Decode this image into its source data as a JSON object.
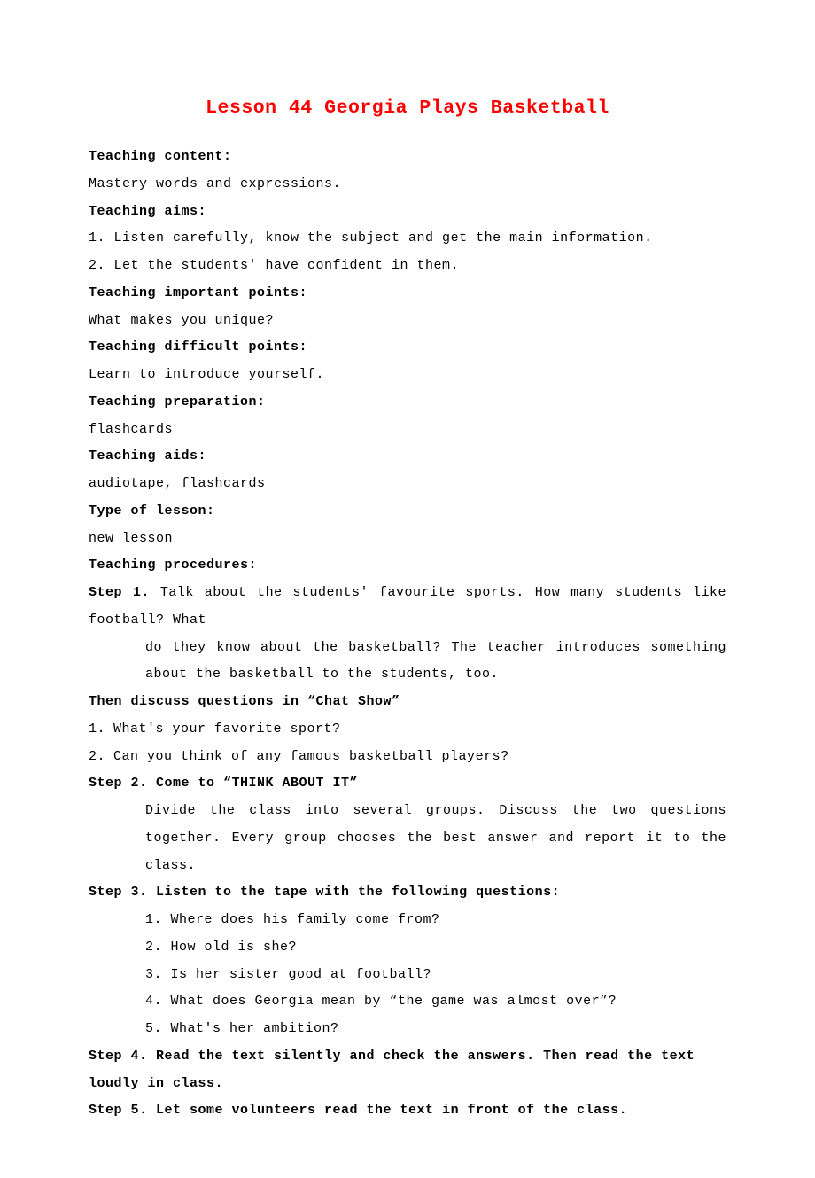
{
  "title": "Lesson 44 Georgia Plays Basketball",
  "sections": {
    "teaching_content": {
      "heading": "Teaching content:",
      "body": "Mastery words and expressions."
    },
    "teaching_aims": {
      "heading": "Teaching aims:",
      "items": [
        "1. Listen carefully, know the subject and get the main information.",
        "2. Let the students'  have confident in them."
      ]
    },
    "important_points": {
      "heading": "Teaching important points:",
      "body": "What makes you unique?"
    },
    "difficult_points": {
      "heading": "Teaching difficult points:",
      "body": "Learn to introduce yourself."
    },
    "preparation": {
      "heading": "Teaching preparation:",
      "body": "flashcards"
    },
    "aids": {
      "heading": "Teaching aids:",
      "body": "audiotape, flashcards"
    },
    "lesson_type": {
      "heading": "Type of lesson:",
      "body": "new lesson"
    },
    "procedures": {
      "heading": "Teaching procedures:"
    }
  },
  "step1": {
    "label": "Step 1.",
    "line1_tail": " Talk about the students'  favourite sports. How many students like football? What",
    "line2": "do they know about the basketball? The teacher introduces something about the basketball to the students, too."
  },
  "chat_show": {
    "heading": "Then discuss questions in “Chat Show”",
    "items": [
      {
        "num": "1.",
        "text": "What's your favorite sport?"
      },
      {
        "num": "2.",
        "text": "Can you think of any famous basketball players?"
      }
    ]
  },
  "step2": {
    "heading": "Step 2. Come to “THINK ABOUT IT”",
    "body": "Divide the class into several groups. Discuss the two questions together. Every group chooses the best answer and report it to the class."
  },
  "step3": {
    "heading": "Step 3. Listen to the tape with the following questions:",
    "items": [
      "1. Where does his family come from?",
      "2. How old is she?",
      "3. Is her sister good at football?",
      "4. What does Georgia mean by “the game was almost over”?",
      "5. What's her ambition?"
    ]
  },
  "step4": {
    "heading": "Step 4. Read the text silently and check the answers. Then read the text loudly in class."
  },
  "step5": {
    "heading": "Step 5. Let some volunteers read the text in front of the class."
  }
}
